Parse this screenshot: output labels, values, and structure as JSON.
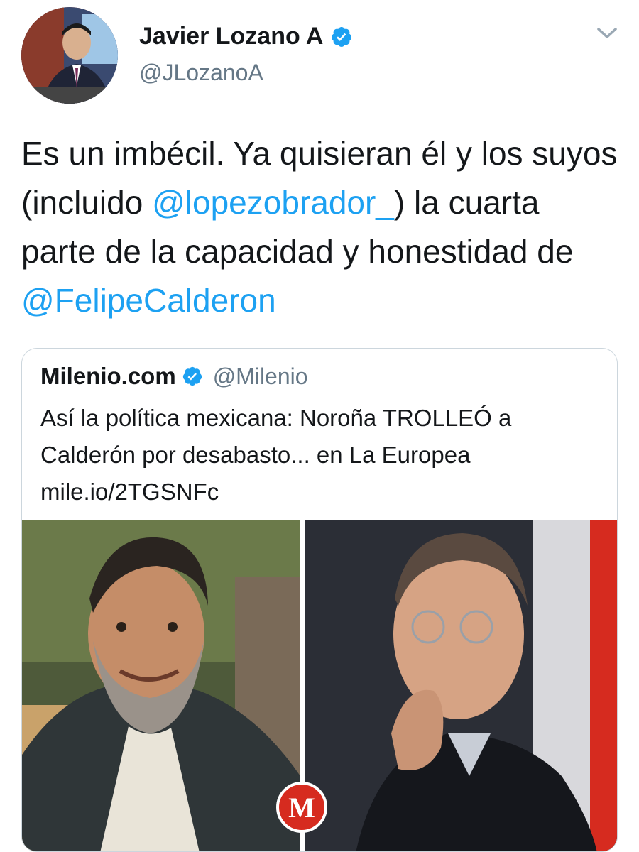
{
  "author": {
    "display_name": "Javier Lozano A",
    "handle": "@JLozanoA",
    "verified": true,
    "avatar_icon": "profile-photo"
  },
  "tweet": {
    "text_part1": "Es un imbécil. Ya quisieran él y los suyos (incluido ",
    "mention1": "@lopezobrador_",
    "text_part2": ") la cuarta parte de la capacidad y honestidad de ",
    "mention2": "@FelipeCalderon"
  },
  "quoted_tweet": {
    "display_name": "Milenio.com",
    "handle": "@Milenio",
    "verified": true,
    "text": "Así la política mexicana: Noroña TROLLEÓ a Calderón por desabasto... en La Europea",
    "link": "mile.io/2TGSNFc",
    "media_logo_letter": "M"
  },
  "colors": {
    "link_blue": "#1da1f2",
    "verified_blue": "#1da1f2",
    "secondary_text": "#657786",
    "border": "#ccd6dd",
    "milenio_red": "#d62b1f"
  }
}
